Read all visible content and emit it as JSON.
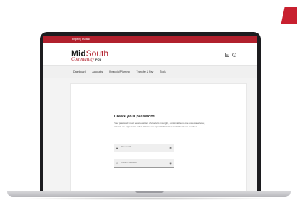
{
  "colors": {
    "brand": "#b1202d",
    "accent": "#c8202f",
    "bezel": "#1c1c1f"
  },
  "topbar": {
    "language": "English | Español"
  },
  "logo": {
    "mid": "Mid",
    "south": "South",
    "community": "Community",
    "fcu": "FCU"
  },
  "header": {
    "icons": [
      "message-icon",
      "profile-icon"
    ]
  },
  "nav": {
    "items": [
      "Dashboard",
      "Accounts",
      "Financial Planning",
      "Transfer & Pay",
      "Tools"
    ]
  },
  "form": {
    "title": "Create your password",
    "description": "Your password must be at least ten characters in length, contain at least one lowercase letter, at least one uppercase letter, at least one special character, and at least one number.",
    "password_label": "Password *",
    "confirm_label": "Confirm Password *"
  }
}
